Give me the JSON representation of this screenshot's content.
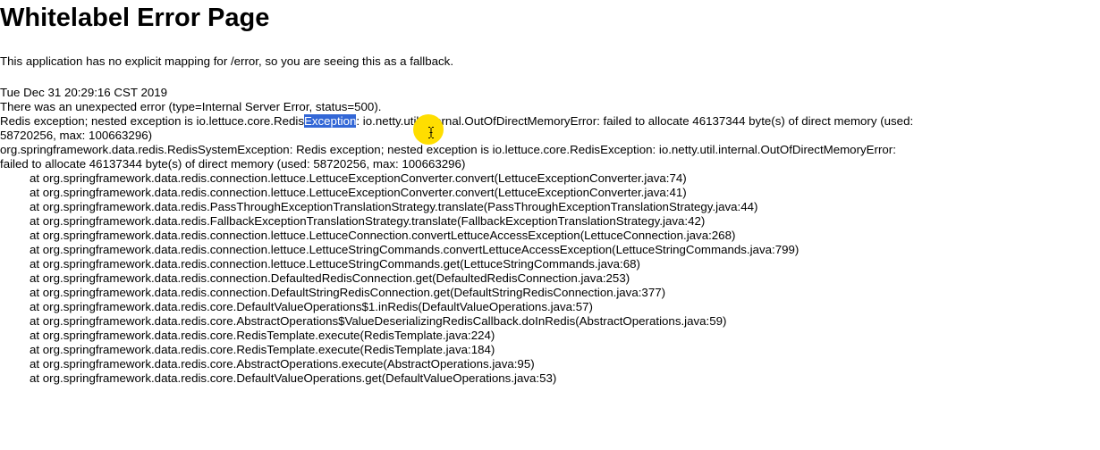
{
  "page": {
    "title": "Whitelabel Error Page",
    "explanation": "This application has no explicit mapping for /error, so you are seeing this as a fallback.",
    "timestamp": "Tue Dec 31 20:29:16 CST 2019",
    "error_summary": "There was an unexpected error (type=Internal Server Error, status=500).",
    "message": {
      "before_highlight": "Redis exception; nested exception is io.lettuce.core.Redis",
      "highlight": "Exception",
      "after_highlight": ": io.netty.util.internal.OutOfDirectMemoryError: failed to allocate 46137344 byte(s) of direct memory (used:",
      "continuation": "58720256, max: 100663296)"
    },
    "exception": {
      "line1": "org.springframework.data.redis.RedisSystemException: Redis exception; nested exception is io.lettuce.core.RedisException: io.netty.util.internal.OutOfDirectMemoryError:",
      "line2": "failed to allocate 46137344 byte(s) of direct memory (used: 58720256, max: 100663296)"
    },
    "stack_trace": [
      "at org.springframework.data.redis.connection.lettuce.LettuceExceptionConverter.convert(LettuceExceptionConverter.java:74)",
      "at org.springframework.data.redis.connection.lettuce.LettuceExceptionConverter.convert(LettuceExceptionConverter.java:41)",
      "at org.springframework.data.redis.PassThroughExceptionTranslationStrategy.translate(PassThroughExceptionTranslationStrategy.java:44)",
      "at org.springframework.data.redis.FallbackExceptionTranslationStrategy.translate(FallbackExceptionTranslationStrategy.java:42)",
      "at org.springframework.data.redis.connection.lettuce.LettuceConnection.convertLettuceAccessException(LettuceConnection.java:268)",
      "at org.springframework.data.redis.connection.lettuce.LettuceStringCommands.convertLettuceAccessException(LettuceStringCommands.java:799)",
      "at org.springframework.data.redis.connection.lettuce.LettuceStringCommands.get(LettuceStringCommands.java:68)",
      "at org.springframework.data.redis.connection.DefaultedRedisConnection.get(DefaultedRedisConnection.java:253)",
      "at org.springframework.data.redis.connection.DefaultStringRedisConnection.get(DefaultStringRedisConnection.java:377)",
      "at org.springframework.data.redis.core.DefaultValueOperations$1.inRedis(DefaultValueOperations.java:57)",
      "at org.springframework.data.redis.core.AbstractOperations$ValueDeserializingRedisCallback.doInRedis(AbstractOperations.java:59)",
      "at org.springframework.data.redis.core.RedisTemplate.execute(RedisTemplate.java:224)",
      "at org.springframework.data.redis.core.RedisTemplate.execute(RedisTemplate.java:184)",
      "at org.springframework.data.redis.core.AbstractOperations.execute(AbstractOperations.java:95)",
      "at org.springframework.data.redis.core.DefaultValueOperations.get(DefaultValueOperations.java:53)"
    ]
  },
  "colors": {
    "selection_highlight": "#3367d6",
    "cursor_halo": "#ffde00"
  },
  "icons": {
    "cursor": "text-ibeam-cursor-icon"
  }
}
